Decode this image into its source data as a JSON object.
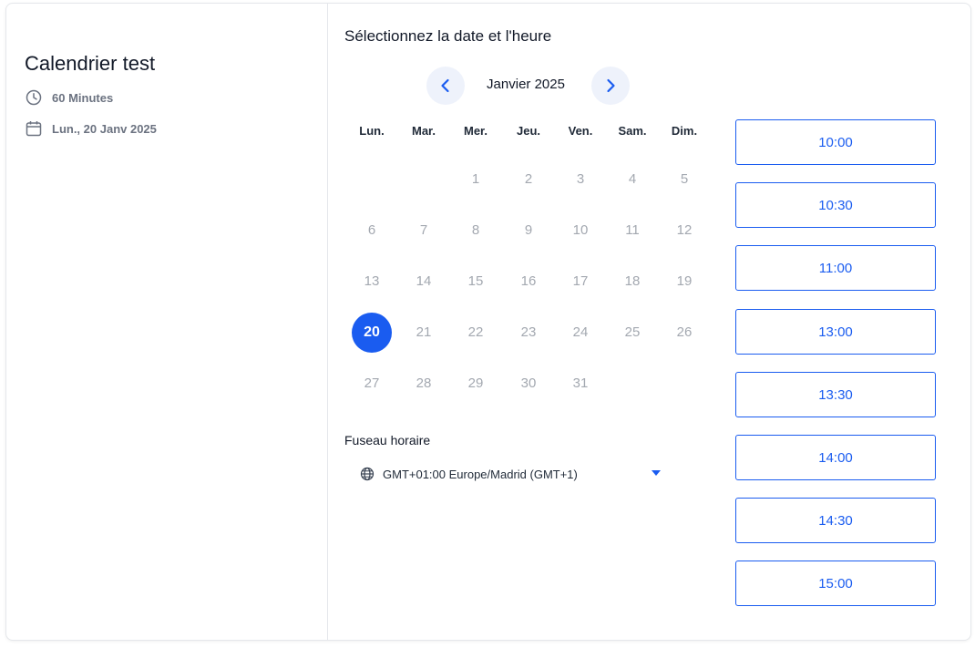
{
  "event": {
    "title": "Calendrier test",
    "duration": "60 Minutes",
    "date": "Lun., 20 Janv 2025",
    "duration_icon": "clock-icon",
    "date_icon": "calendar-icon"
  },
  "calendar": {
    "heading": "Sélectionnez la date et l'heure",
    "month": "Janvier 2025",
    "prev_icon": "chevron-left-icon",
    "next_icon": "chevron-right-icon",
    "weekdays": [
      "Lun.",
      "Mar.",
      "Mer.",
      "Jeu.",
      "Ven.",
      "Sam.",
      "Dim."
    ],
    "weeks": [
      [
        "",
        "",
        "1",
        "2",
        "3",
        "4",
        "5"
      ],
      [
        "6",
        "7",
        "8",
        "9",
        "10",
        "11",
        "12"
      ],
      [
        "13",
        "14",
        "15",
        "16",
        "17",
        "18",
        "19"
      ],
      [
        "20",
        "21",
        "22",
        "23",
        "24",
        "25",
        "26"
      ],
      [
        "27",
        "28",
        "29",
        "30",
        "31",
        "",
        ""
      ]
    ],
    "selected_day": "20",
    "accent_color": "#1a5cf0"
  },
  "timezone": {
    "label": "Fuseau horaire",
    "value": "GMT+01:00 Europe/Madrid (GMT+1)",
    "icon": "globe-icon"
  },
  "slots": [
    "10:00",
    "10:30",
    "11:00",
    "13:00",
    "13:30",
    "14:00",
    "14:30",
    "15:00"
  ]
}
